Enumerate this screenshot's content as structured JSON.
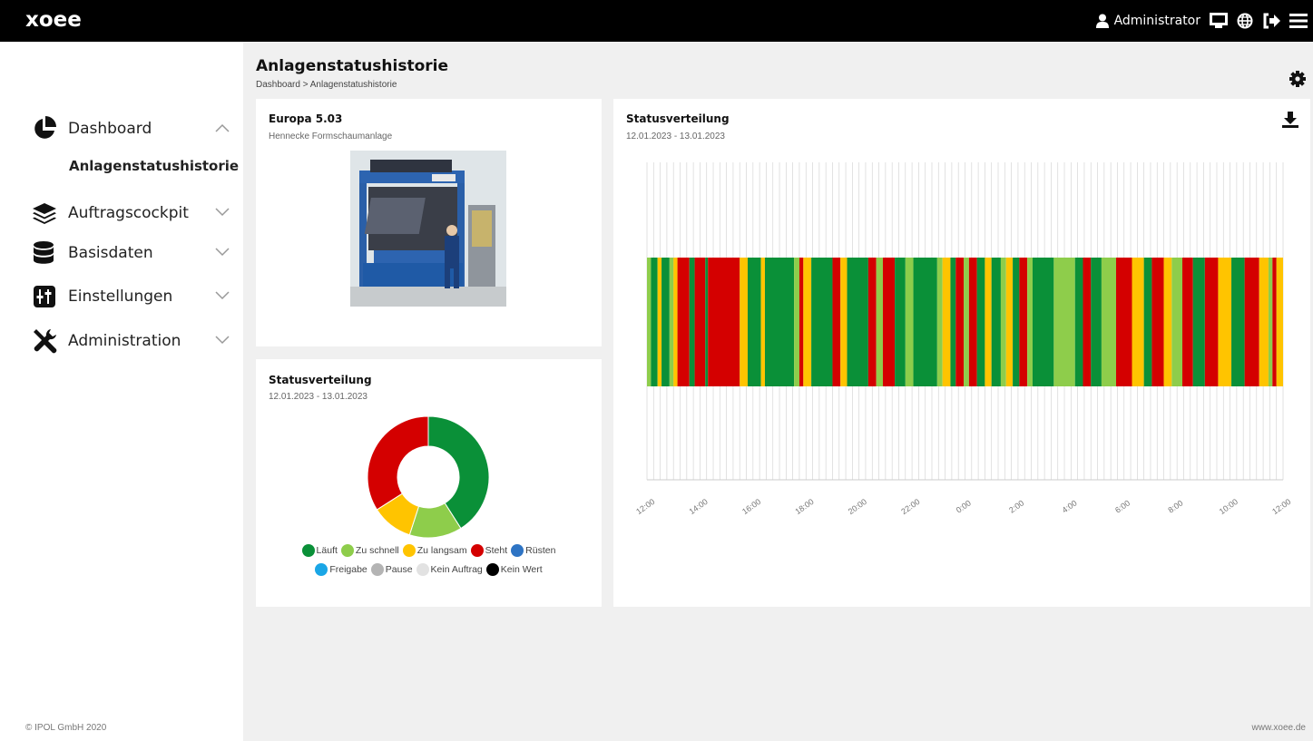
{
  "app": {
    "logo_text": "xoee",
    "user": "Administrator",
    "icons": [
      "user-icon",
      "monitor-icon",
      "globe-icon",
      "logout-icon",
      "menu-icon"
    ]
  },
  "sidebar": {
    "items": [
      {
        "label": "Dashboard",
        "icon": "pie-chart-icon",
        "expanded": true
      },
      {
        "label": "Auftragscockpit",
        "icon": "layers-icon",
        "expanded": false
      },
      {
        "label": "Basisdaten",
        "icon": "database-icon",
        "expanded": false
      },
      {
        "label": "Einstellungen",
        "icon": "sliders-icon",
        "expanded": false
      },
      {
        "label": "Administration",
        "icon": "tools-icon",
        "expanded": false
      }
    ],
    "active_sub": "Anlagenstatushistorie",
    "copyright": "© IPOL GmbH 2020"
  },
  "header": {
    "title": "Anlagenstatushistorie",
    "breadcrumb": "Dashboard > Anlagenstatushistorie"
  },
  "footer_url": "www.xoee.de",
  "machine": {
    "name": "Europa 5.03",
    "description": "Hennecke Formschaumanlage"
  },
  "status_donut": {
    "title": "Statusverteilung",
    "range": "12.01.2023 - 13.01.2023"
  },
  "status_timeline": {
    "title": "Statusverteilung",
    "range": "12.01.2023 - 13.01.2023"
  },
  "colors": {
    "Läuft": "#0a9038",
    "Zu schnell": "#8ecd4b",
    "Zu langsam": "#ffc400",
    "Steht": "#d40000",
    "Rüsten": "#2e74c4",
    "Freigabe": "#1aa6e6",
    "Pause": "#b4b4b4",
    "Kein Auftrag": "#e2e2e2",
    "Kein Wert": "#000000"
  },
  "chart_data": [
    {
      "type": "pie",
      "title": "Statusverteilung",
      "subtitle": "12.01.2023 - 13.01.2023",
      "legend": [
        "Läuft",
        "Zu schnell",
        "Zu langsam",
        "Steht",
        "Rüsten",
        "Freigabe",
        "Pause",
        "Kein Auftrag",
        "Kein Wert"
      ],
      "slices": [
        {
          "name": "Läuft",
          "value": 41
        },
        {
          "name": "Zu schnell",
          "value": 14
        },
        {
          "name": "Zu langsam",
          "value": 11
        },
        {
          "name": "Steht",
          "value": 34
        },
        {
          "name": "Rüsten",
          "value": 0
        },
        {
          "name": "Freigabe",
          "value": 0
        },
        {
          "name": "Pause",
          "value": 0
        },
        {
          "name": "Kein Auftrag",
          "value": 0
        },
        {
          "name": "Kein Wert",
          "value": 0
        }
      ]
    },
    {
      "type": "timeline",
      "title": "Statusverteilung",
      "subtitle": "12.01.2023 - 13.01.2023",
      "x_ticks": [
        "12:00",
        "14:00",
        "16:00",
        "18:00",
        "20:00",
        "22:00",
        "0:00",
        "2:00",
        "4:00",
        "6:00",
        "8:00",
        "10:00",
        "12:00"
      ],
      "x_range_hours": [
        12,
        36
      ],
      "grid": true,
      "segments": [
        {
          "start": 12.0,
          "end": 12.15,
          "status": "Zu schnell"
        },
        {
          "start": 12.15,
          "end": 12.4,
          "status": "Läuft"
        },
        {
          "start": 12.4,
          "end": 12.55,
          "status": "Zu langsam"
        },
        {
          "start": 12.55,
          "end": 12.85,
          "status": "Läuft"
        },
        {
          "start": 12.85,
          "end": 13.0,
          "status": "Zu schnell"
        },
        {
          "start": 13.0,
          "end": 13.15,
          "status": "Zu langsam"
        },
        {
          "start": 13.15,
          "end": 13.6,
          "status": "Steht"
        },
        {
          "start": 13.6,
          "end": 13.8,
          "status": "Läuft"
        },
        {
          "start": 13.8,
          "end": 14.2,
          "status": "Steht"
        },
        {
          "start": 14.2,
          "end": 14.3,
          "status": "Läuft"
        },
        {
          "start": 14.3,
          "end": 15.5,
          "status": "Steht"
        },
        {
          "start": 15.5,
          "end": 15.8,
          "status": "Zu langsam"
        },
        {
          "start": 15.8,
          "end": 16.3,
          "status": "Läuft"
        },
        {
          "start": 16.3,
          "end": 16.45,
          "status": "Zu langsam"
        },
        {
          "start": 16.45,
          "end": 17.55,
          "status": "Läuft"
        },
        {
          "start": 17.55,
          "end": 17.75,
          "status": "Zu schnell"
        },
        {
          "start": 17.75,
          "end": 17.9,
          "status": "Steht"
        },
        {
          "start": 17.9,
          "end": 18.2,
          "status": "Zu langsam"
        },
        {
          "start": 18.2,
          "end": 19.0,
          "status": "Läuft"
        },
        {
          "start": 19.0,
          "end": 19.3,
          "status": "Steht"
        },
        {
          "start": 19.3,
          "end": 19.55,
          "status": "Zu langsam"
        },
        {
          "start": 19.55,
          "end": 20.35,
          "status": "Läuft"
        },
        {
          "start": 20.35,
          "end": 20.65,
          "status": "Steht"
        },
        {
          "start": 20.65,
          "end": 20.9,
          "status": "Zu schnell"
        },
        {
          "start": 20.9,
          "end": 21.35,
          "status": "Steht"
        },
        {
          "start": 21.35,
          "end": 21.75,
          "status": "Läuft"
        },
        {
          "start": 21.75,
          "end": 22.05,
          "status": "Zu schnell"
        },
        {
          "start": 22.05,
          "end": 22.95,
          "status": "Läuft"
        },
        {
          "start": 22.95,
          "end": 23.15,
          "status": "Zu schnell"
        },
        {
          "start": 23.15,
          "end": 23.45,
          "status": "Zu langsam"
        },
        {
          "start": 23.45,
          "end": 23.65,
          "status": "Läuft"
        },
        {
          "start": 23.65,
          "end": 23.95,
          "status": "Steht"
        },
        {
          "start": 23.95,
          "end": 24.15,
          "status": "Zu schnell"
        },
        {
          "start": 24.15,
          "end": 24.45,
          "status": "Steht"
        },
        {
          "start": 24.45,
          "end": 24.75,
          "status": "Läuft"
        },
        {
          "start": 24.75,
          "end": 25.0,
          "status": "Zu langsam"
        },
        {
          "start": 25.0,
          "end": 25.35,
          "status": "Läuft"
        },
        {
          "start": 25.35,
          "end": 25.55,
          "status": "Zu schnell"
        },
        {
          "start": 25.55,
          "end": 25.8,
          "status": "Zu langsam"
        },
        {
          "start": 25.8,
          "end": 26.05,
          "status": "Läuft"
        },
        {
          "start": 26.05,
          "end": 26.35,
          "status": "Steht"
        },
        {
          "start": 26.35,
          "end": 26.55,
          "status": "Zu schnell"
        },
        {
          "start": 26.55,
          "end": 27.35,
          "status": "Läuft"
        },
        {
          "start": 27.35,
          "end": 28.15,
          "status": "Zu schnell"
        },
        {
          "start": 28.15,
          "end": 28.45,
          "status": "Läuft"
        },
        {
          "start": 28.45,
          "end": 28.75,
          "status": "Steht"
        },
        {
          "start": 28.75,
          "end": 29.15,
          "status": "Läuft"
        },
        {
          "start": 29.15,
          "end": 29.7,
          "status": "Zu schnell"
        },
        {
          "start": 29.7,
          "end": 30.3,
          "status": "Steht"
        },
        {
          "start": 30.3,
          "end": 30.75,
          "status": "Zu langsam"
        },
        {
          "start": 30.75,
          "end": 31.05,
          "status": "Läuft"
        },
        {
          "start": 31.05,
          "end": 31.5,
          "status": "Steht"
        },
        {
          "start": 31.5,
          "end": 31.8,
          "status": "Zu langsam"
        },
        {
          "start": 31.8,
          "end": 32.2,
          "status": "Zu schnell"
        },
        {
          "start": 32.2,
          "end": 32.6,
          "status": "Steht"
        },
        {
          "start": 32.6,
          "end": 33.05,
          "status": "Läuft"
        },
        {
          "start": 33.05,
          "end": 33.55,
          "status": "Steht"
        },
        {
          "start": 33.55,
          "end": 34.05,
          "status": "Zu langsam"
        },
        {
          "start": 34.05,
          "end": 34.55,
          "status": "Läuft"
        },
        {
          "start": 34.55,
          "end": 35.1,
          "status": "Steht"
        },
        {
          "start": 35.1,
          "end": 35.45,
          "status": "Zu langsam"
        },
        {
          "start": 35.45,
          "end": 35.6,
          "status": "Zu schnell"
        },
        {
          "start": 35.6,
          "end": 35.75,
          "status": "Steht"
        },
        {
          "start": 35.75,
          "end": 36.0,
          "status": "Zu langsam"
        }
      ]
    }
  ]
}
